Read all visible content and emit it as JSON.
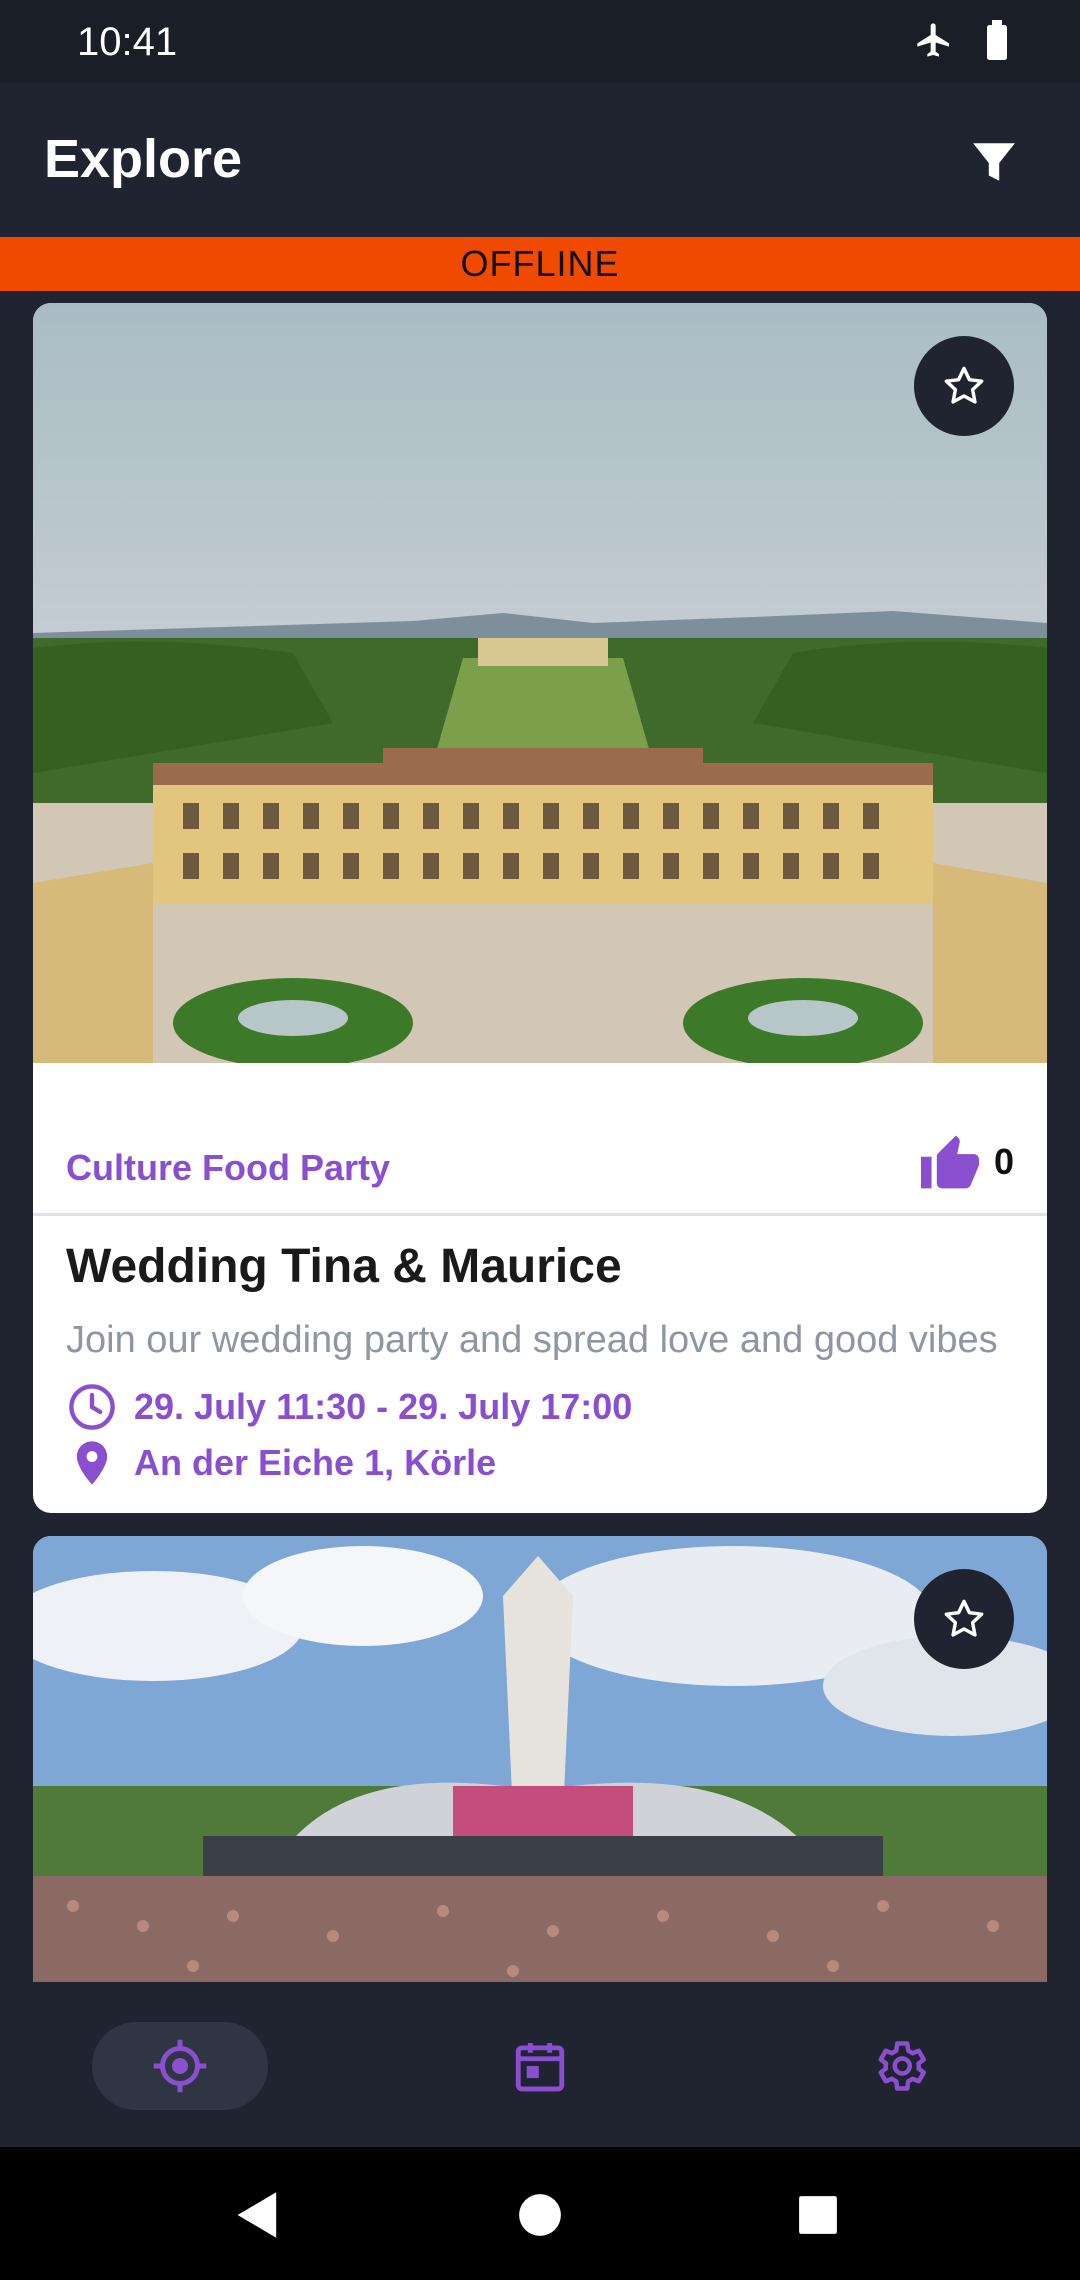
{
  "status_bar": {
    "time": "10:41",
    "icons": [
      "airplane-icon",
      "battery-icon"
    ]
  },
  "app_bar": {
    "title": "Explore",
    "filter_icon": "filter-icon"
  },
  "banner": {
    "text": "OFFLINE",
    "color": "#f04a00"
  },
  "events": [
    {
      "image": "palace-aerial-photo",
      "tags": "Culture Food Party",
      "likes": "0",
      "title": "Wedding Tina & Maurice",
      "description": "Join our wedding party and spread love and good vibes",
      "datetime": "29. July 11:30 - 29. July 17:00",
      "location": "An der Eiche 1, Körle"
    },
    {
      "image": "festival-stage-photo"
    }
  ],
  "bottom_nav": {
    "items": [
      {
        "name": "explore",
        "icon": "location-target-icon",
        "selected": true
      },
      {
        "name": "events",
        "icon": "calendar-icon",
        "selected": false
      },
      {
        "name": "settings",
        "icon": "gear-icon",
        "selected": false
      }
    ]
  },
  "colors": {
    "accent": "#8a4fcf",
    "background": "#1f2430",
    "offline": "#f04a00"
  }
}
